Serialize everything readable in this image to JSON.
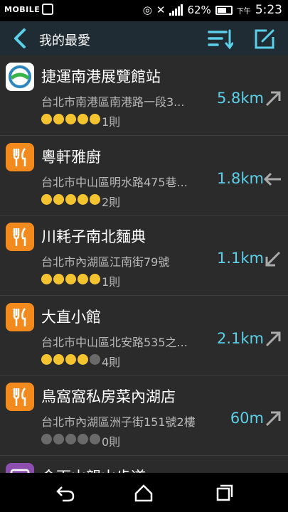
{
  "status_bar": {
    "logo_text": "MOBILE",
    "battery": "62%",
    "ampm": "下午",
    "time": "5:23",
    "icons": [
      "logo-mark-icon",
      "facebook-icon",
      "nfc-icon",
      "mute-icon",
      "data-icon",
      "signal-icon",
      "battery-icon"
    ]
  },
  "header": {
    "title": "我的最愛",
    "back_icon": "back-arrow-icon",
    "sort_icon": "sort-list-icon",
    "edit_icon": "edit-icon",
    "bg_color": "#1f2c33"
  },
  "items": [
    {
      "name": "捷運南港展覽館站",
      "address": "台北市南港區南港路一段3...",
      "rating": 5,
      "count": "1則",
      "distance": "5.8km",
      "direction": "north-east",
      "icon": "mrt-icon"
    },
    {
      "name": "粵軒雅廚",
      "address": "台北市中山區明水路475巷...",
      "rating": 5,
      "count": "2則",
      "distance": "1.8km",
      "direction": "west",
      "icon": "fork-knife-icon"
    },
    {
      "name": "川耗子南北麵典",
      "address": "台北市內湖區江南街79號",
      "rating": 5,
      "count": "1則",
      "distance": "1.1km",
      "direction": "south-west",
      "icon": "fork-knife-icon"
    },
    {
      "name": "大直小館",
      "address": "台北市中山區北安路535之...",
      "rating": 4,
      "count": "4則",
      "distance": "2.1km",
      "direction": "north-east",
      "icon": "fork-knife-icon"
    },
    {
      "name": "鳥窩窩私房菜內湖店",
      "address": "台北市內湖區洲子街151號2樓",
      "rating": 0,
      "count": "0則",
      "distance": "60m",
      "direction": "north-east",
      "icon": "fork-knife-icon"
    },
    {
      "name": "金面山親山步道",
      "address": "",
      "rating": 0,
      "count": "",
      "distance": "",
      "direction": "",
      "icon": "park-icon"
    }
  ],
  "colors": {
    "accent": "#5bd0e8",
    "food_icon": "#f28a1e",
    "star": "#f4c430"
  },
  "nav": {
    "icons": [
      "back-nav-icon",
      "home-nav-icon",
      "recents-nav-icon"
    ]
  }
}
